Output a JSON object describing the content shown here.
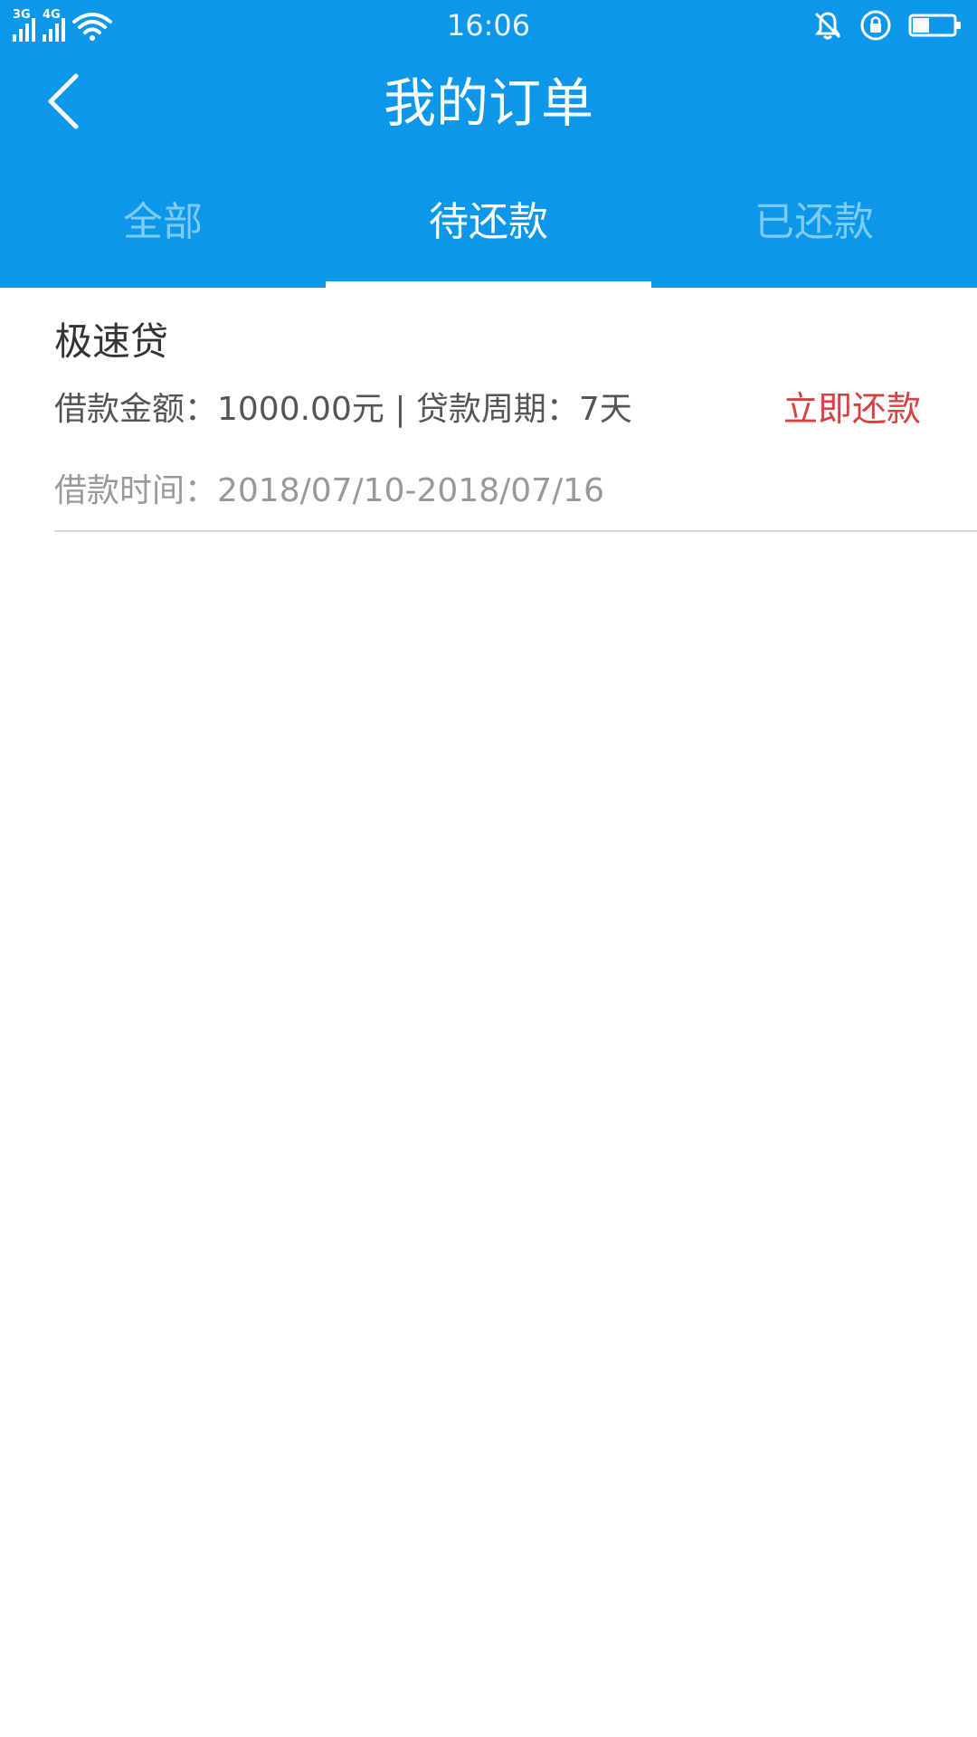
{
  "status_bar": {
    "net1_label": "3G",
    "net2_label": "4G",
    "time": "16:06",
    "icons": [
      "signal-icon",
      "wifi-icon",
      "vibrate-icon",
      "rotation-lock-icon",
      "battery-icon"
    ],
    "battery_level": 0.4
  },
  "app_bar": {
    "back_icon": "chevron-left-icon",
    "title": "我的订单"
  },
  "tabs": [
    {
      "label": "全部",
      "active": false
    },
    {
      "label": "待还款",
      "active": true
    },
    {
      "label": "已还款",
      "active": false
    }
  ],
  "orders": [
    {
      "product": "极速贷",
      "info": "借款金额：1000.00元 | 贷款周期：7天",
      "action_label": "立即还款",
      "time": "借款时间：2018/07/10-2018/07/16"
    }
  ],
  "colors": {
    "primary": "#0c97ea",
    "tab_inactive": "#7ecbf4",
    "action": "#d94040",
    "divider": "#d8d8d8"
  }
}
